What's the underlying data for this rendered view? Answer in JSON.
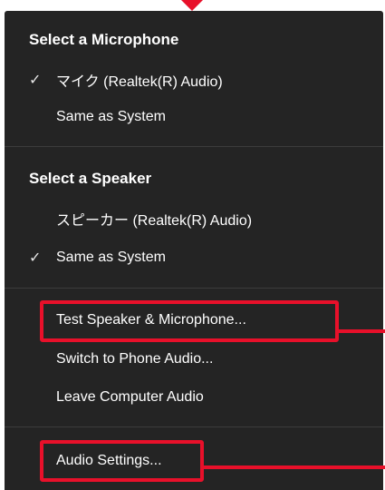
{
  "microphone": {
    "title": "Select a Microphone",
    "items": [
      {
        "label": "マイク (Realtek(R) Audio)",
        "checked": true
      },
      {
        "label": "Same as System",
        "checked": false
      }
    ]
  },
  "speaker": {
    "title": "Select a Speaker",
    "items": [
      {
        "label": "スピーカー (Realtek(R) Audio)",
        "checked": false
      },
      {
        "label": "Same as System",
        "checked": true
      }
    ]
  },
  "actions": {
    "test": "Test Speaker & Microphone...",
    "switch_phone": "Switch to Phone Audio...",
    "leave": "Leave Computer Audio",
    "settings": "Audio Settings..."
  },
  "check_glyph": "✓",
  "colors": {
    "menu_bg": "#242424",
    "text": "#ffffff",
    "divider": "#3c3c3c",
    "highlight": "#e8102a"
  }
}
